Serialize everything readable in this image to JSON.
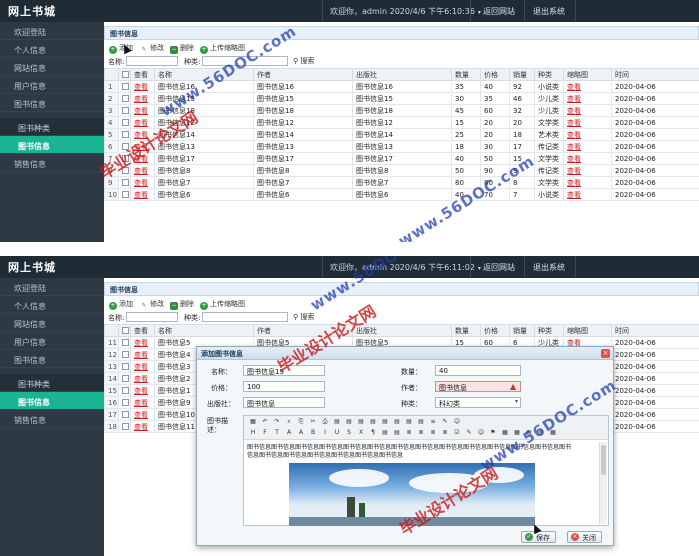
{
  "app": {
    "title": "网上书城",
    "welcome": "欢迎你，admin  2020/4/6 下午6:10:36",
    "welcome2": "欢迎你，admin  2020/4/6 下午6:11:02",
    "caret": "▾",
    "links": [
      "返回网站",
      "退出系统"
    ]
  },
  "sidebar": {
    "items": [
      "欢迎登陆",
      "个人信息",
      "网站信息",
      "用户信息",
      "图书信息",
      "图书种类",
      "图书信息",
      "销售信息"
    ]
  },
  "panel": {
    "title": "图书信息",
    "toolbar": [
      "添加",
      "修改",
      "删除",
      "上传缩略图"
    ],
    "search": {
      "name_label": "名称:",
      "type_label": "种类:",
      "button": "搜索"
    }
  },
  "table": {
    "columns": [
      "",
      "",
      "查看",
      "名称",
      "作者",
      "出版社",
      "数量",
      "价格",
      "销量",
      "种类",
      "缩略图",
      "时间"
    ],
    "rows1": [
      [
        "1",
        "查看",
        "图书信息16",
        "图书信息16",
        "图书信息16",
        "35",
        "40",
        "92",
        "小说类",
        "查看",
        "2020-04-06"
      ],
      [
        "2",
        "查看",
        "图书信息15",
        "图书信息15",
        "图书信息15",
        "30",
        "35",
        "46",
        "少儿类",
        "查看",
        "2020-04-06"
      ],
      [
        "3",
        "查看",
        "图书信息18",
        "图书信息18",
        "图书信息18",
        "45",
        "60",
        "32",
        "少儿类",
        "查看",
        "2020-04-06"
      ],
      [
        "4",
        "查看",
        "图书信息12",
        "图书信息12",
        "图书信息12",
        "15",
        "20",
        "20",
        "文学类",
        "查看",
        "2020-04-06"
      ],
      [
        "5",
        "查看",
        "图书信息14",
        "图书信息14",
        "图书信息14",
        "25",
        "20",
        "18",
        "艺术类",
        "查看",
        "2020-04-06"
      ],
      [
        "6",
        "查看",
        "图书信息13",
        "图书信息13",
        "图书信息13",
        "18",
        "30",
        "17",
        "传记类",
        "查看",
        "2020-04-06"
      ],
      [
        "7",
        "查看",
        "图书信息17",
        "图书信息17",
        "图书信息17",
        "40",
        "50",
        "15",
        "文学类",
        "查看",
        "2020-04-06"
      ],
      [
        "8",
        "查看",
        "图书信息8",
        "图书信息8",
        "图书信息8",
        "50",
        "90",
        "9",
        "传记类",
        "查看",
        "2020-04-06"
      ],
      [
        "9",
        "查看",
        "图书信息7",
        "图书信息7",
        "图书信息7",
        "80",
        "80",
        "8",
        "文学类",
        "查看",
        "2020-04-06"
      ],
      [
        "10",
        "查看",
        "图书信息6",
        "图书信息6",
        "图书信息6",
        "40",
        "70",
        "7",
        "小说类",
        "查看",
        "2020-04-06"
      ]
    ],
    "rows2": [
      [
        "11",
        "查看",
        "图书信息5",
        "图书信息5",
        "图书信息5",
        "15",
        "60",
        "6",
        "少儿类",
        "查看",
        "2020-04-06"
      ],
      [
        "12",
        "查看",
        "图书信息4",
        "",
        "",
        "",
        "",
        "",
        "",
        "查看",
        "2020-04-06"
      ],
      [
        "13",
        "查看",
        "图书信息3",
        "",
        "",
        "",
        "",
        "",
        "",
        "查看",
        "2020-04-06"
      ],
      [
        "14",
        "查看",
        "图书信息2",
        "",
        "",
        "",
        "",
        "",
        "",
        "查看",
        "2020-04-06"
      ],
      [
        "15",
        "查看",
        "图书信息1",
        "",
        "",
        "",
        "",
        "",
        "",
        "查看",
        "2020-04-06"
      ],
      [
        "16",
        "查看",
        "图书信息9",
        "",
        "",
        "",
        "",
        "",
        "",
        "查看",
        "2020-04-06"
      ],
      [
        "17",
        "查看",
        "图书信息10",
        "",
        "",
        "",
        "",
        "",
        "",
        "查看",
        "2020-04-06"
      ],
      [
        "18",
        "查看",
        "图书信息11",
        "",
        "",
        "",
        "",
        "",
        "",
        "查看",
        "2020-04-06"
      ]
    ]
  },
  "dialog": {
    "title": "添加图书信息",
    "close": "×",
    "labels": {
      "name": "名称：",
      "quantity": "数量：",
      "price": "价格：",
      "author": "作者：",
      "publisher": "出版社：",
      "type": "种类：",
      "desc": "图书描述："
    },
    "values": {
      "name": "图书信息19",
      "quantity": "40",
      "price": "100",
      "author": "图书信息",
      "publisher": "图书信息",
      "type": "科幻类"
    },
    "editor_text": "图书信息图书信息图书信息图书信息图书信息图书信息图书信息图书信息图书信息图书信息图书信息图书信息图书信息图书信息图书信息图书信息图书信息图书信息图书信息图书信息",
    "buttons": {
      "save": "保存",
      "close": "关闭"
    }
  },
  "watermarks": {
    "red": "毕业设计论文网",
    "blue": "www.56DOC.com"
  },
  "icons": [
    "add-icon",
    "edit-icon",
    "delete-icon",
    "upload-icon",
    "search-icon",
    "checkbox-icon",
    "close-icon",
    "save-icon",
    "cursor-icon"
  ],
  "colors": {
    "topbar": "#1f2c36",
    "sidebar": "#2d3a44",
    "active": "#1ab394",
    "link": "#c81e1e"
  }
}
